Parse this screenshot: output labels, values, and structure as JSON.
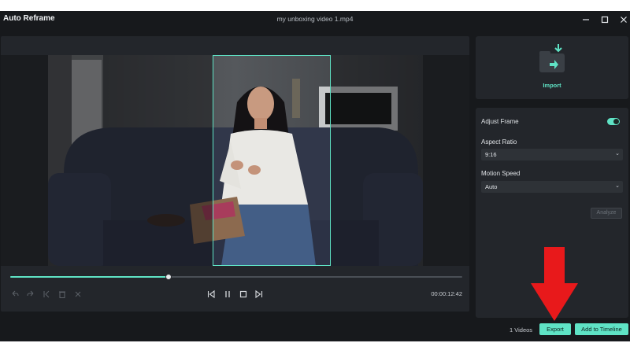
{
  "window": {
    "title": "Auto Reframe",
    "file_name": "my unboxing video 1.mp4",
    "controls": {
      "minimize_icon": "minimize-icon",
      "maximize_icon": "maximize-icon",
      "close_icon": "close-icon"
    }
  },
  "preview": {
    "progress_fraction": 0.35,
    "timecode": "00:00:12:42",
    "edit_controls": [
      "undo-icon",
      "redo-icon",
      "split-start-icon",
      "delete-icon",
      "close-clip-icon"
    ],
    "playback_controls": [
      "previous-frame-icon",
      "pause-icon",
      "stop-icon",
      "next-frame-icon"
    ]
  },
  "import": {
    "label": "Import",
    "icon": "import-folder-icon"
  },
  "settings": {
    "adjust_frame_label": "Adjust Frame",
    "adjust_frame_on": true,
    "aspect_ratio_label": "Aspect Ratio",
    "aspect_ratio_value": "9:16",
    "motion_speed_label": "Motion Speed",
    "motion_speed_value": "Auto",
    "analyze_label": "Analyze"
  },
  "footer": {
    "video_count": "1 Videos",
    "export_label": "Export",
    "add_to_timeline_label": "Add to Timeline"
  },
  "colors": {
    "accent": "#5fe3c5",
    "annotation_arrow": "#e8191b",
    "background": "#17191c",
    "panel": "#23262b"
  }
}
